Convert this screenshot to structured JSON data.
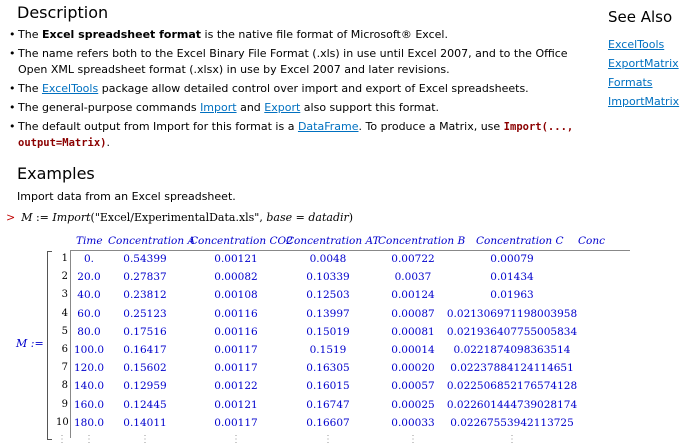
{
  "description": {
    "title": "Description",
    "bullets": {
      "b1": {
        "pre": "The ",
        "bold": "Excel spreadsheet format",
        "post": " is the native file format of Microsoft® Excel."
      },
      "b2": {
        "text": "The name refers both to the Excel Binary File Format (.xls) in use until Excel 2007, and to the Office Open XML spreadsheet format (.xlsx) in use by Excel 2007 and later revisions."
      },
      "b3": {
        "pre": "The ",
        "link": "ExcelTools",
        "post": " package allow detailed control over import and export of Excel spreadsheets."
      },
      "b4": {
        "pre": "The general-purpose commands ",
        "link1": "Import",
        "mid": " and ",
        "link2": "Export",
        "post": " also support this format."
      },
      "b5": {
        "pre": "The default output from Import for this format is a ",
        "link": "DataFrame",
        "mid": ". To produce a Matrix, use ",
        "code": "Import(...,  output=Matrix)",
        "post": "."
      }
    }
  },
  "see_also": {
    "title": "See Also",
    "links": [
      "ExcelTools",
      "ExportMatrix",
      "Formats",
      "ImportMatrix"
    ]
  },
  "examples": {
    "title": "Examples",
    "intro": "Import data from an Excel spreadsheet.",
    "command": {
      "prompt": ">",
      "lhs": "M",
      "assign": " := ",
      "func": "Import",
      "args": "(\"Excel/ExperimentalData.xls\", ",
      "base_kw": "base",
      "eq": " = ",
      "base_val": "datadir",
      "close": ")"
    },
    "result_label": "M :=",
    "matrix": {
      "headers": [
        "Time",
        "Concentration A",
        "Concentration CO2",
        "Concentration AT",
        "Concentration B",
        "Concentration C",
        "Conc"
      ],
      "row_numbers": [
        "1",
        "2",
        "3",
        "4",
        "5",
        "6",
        "7",
        "8",
        "9",
        "10"
      ],
      "rows": [
        [
          "0.",
          "0.54399",
          "0.00121",
          "0.0048",
          "0.00722",
          "0.00079"
        ],
        [
          "20.0",
          "0.27837",
          "0.00082",
          "0.10339",
          "0.0037",
          "0.01434"
        ],
        [
          "40.0",
          "0.23812",
          "0.00108",
          "0.12503",
          "0.00124",
          "0.01963"
        ],
        [
          "60.0",
          "0.25123",
          "0.00116",
          "0.13997",
          "0.00087",
          "0.021306971198003958"
        ],
        [
          "80.0",
          "0.17516",
          "0.00116",
          "0.15019",
          "0.00081",
          "0.021936407755005834"
        ],
        [
          "100.0",
          "0.16417",
          "0.00117",
          "0.1519",
          "0.00014",
          "0.0221874098363514"
        ],
        [
          "120.0",
          "0.15602",
          "0.00117",
          "0.16305",
          "0.00020",
          "0.02237884124114651"
        ],
        [
          "140.0",
          "0.12959",
          "0.00122",
          "0.16015",
          "0.00057",
          "0.022506852176574128"
        ],
        [
          "160.0",
          "0.12445",
          "0.00121",
          "0.16747",
          "0.00025",
          "0.022601444739028174"
        ],
        [
          "180.0",
          "0.14011",
          "0.00117",
          "0.16607",
          "0.00033",
          "0.02267553942113725"
        ]
      ],
      "ellipsis": "⋮"
    }
  },
  "colors": {
    "link": "#0070c0",
    "matrix_text": "#0000cc",
    "prompt": "#c00000",
    "code": "#8b0000"
  }
}
